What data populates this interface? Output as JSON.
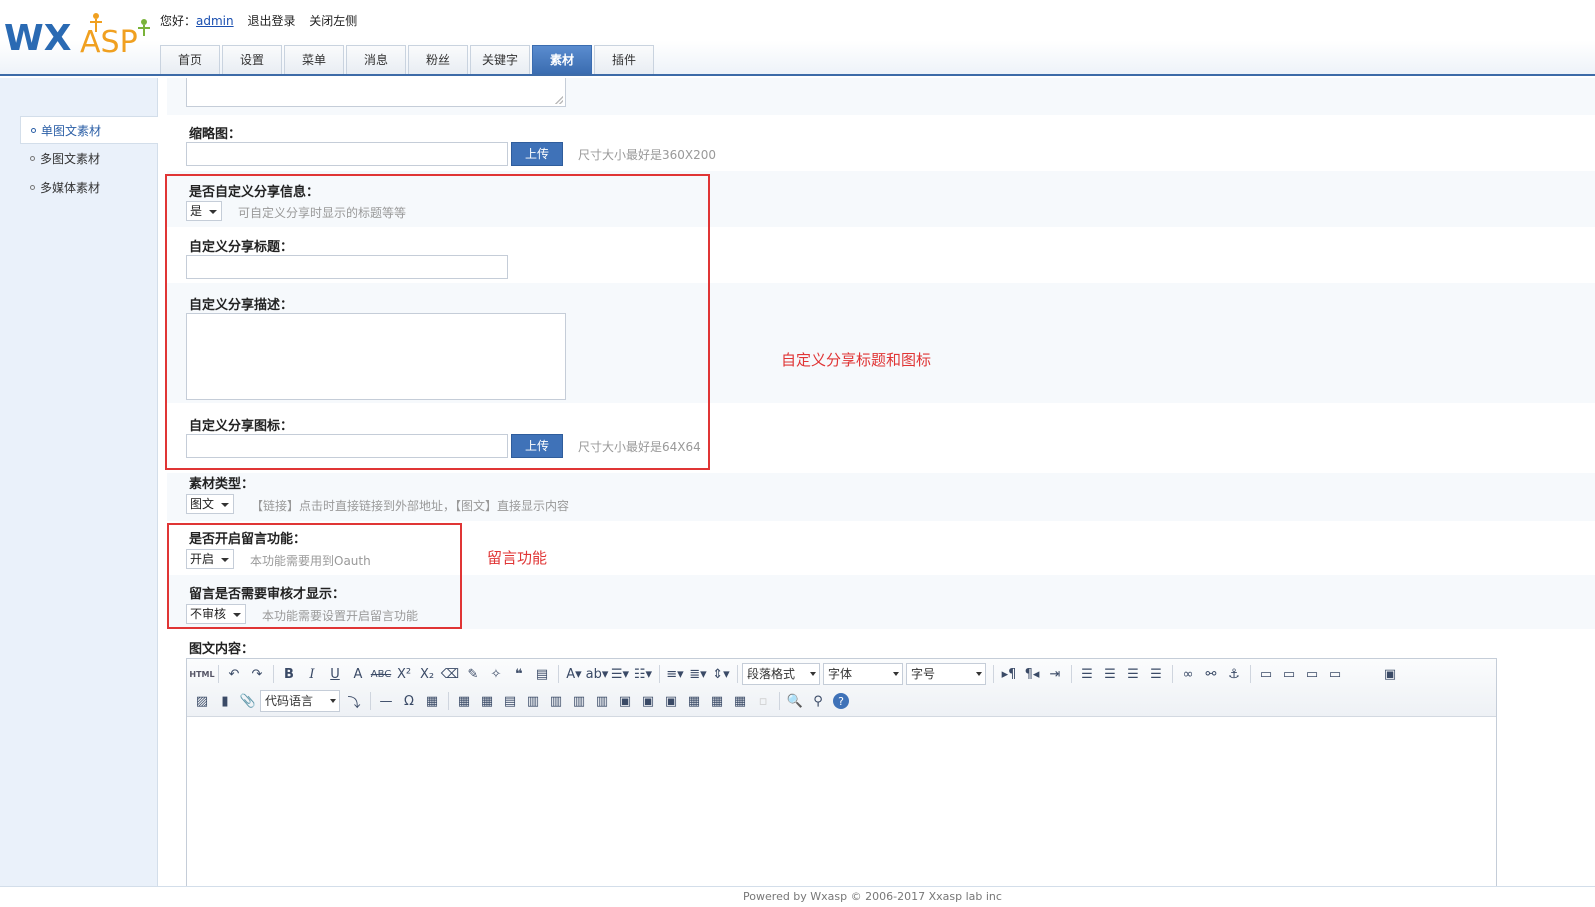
{
  "header": {
    "logo_text_wx": "WX",
    "logo_text_asp": "ASP",
    "greeting": "您好：",
    "username": "admin",
    "logout": "退出登录",
    "close_left": "关闭左侧",
    "tabs": [
      "首页",
      "设置",
      "菜单",
      "消息",
      "粉丝",
      "关键字",
      "素材",
      "插件"
    ],
    "active_tab": "素材"
  },
  "sidebar": {
    "items": [
      "单图文素材",
      "多图文素材",
      "多媒体素材"
    ],
    "active_item": "单图文素材"
  },
  "form": {
    "thumb": {
      "label": "缩略图：",
      "button": "上传",
      "hint": "尺寸大小最好是360X200",
      "value": ""
    },
    "share_custom": {
      "label": "是否自定义分享信息：",
      "value": "是",
      "hint": "可自定义分享时显示的标题等等"
    },
    "share_title": {
      "label": "自定义分享标题：",
      "value": ""
    },
    "share_desc": {
      "label": "自定义分享描述：",
      "value": ""
    },
    "share_icon": {
      "label": "自定义分享图标：",
      "button": "上传",
      "hint": "尺寸大小最好是64X64",
      "value": ""
    },
    "material_type": {
      "label": "素材类型：",
      "value": "图文",
      "hint": "【链接】点击时直接链接到外部地址，【图文】直接显示内容"
    },
    "comment_enable": {
      "label": "是否开启留言功能：",
      "value": "开启",
      "hint": "本功能需要用到Oauth"
    },
    "comment_review": {
      "label": "留言是否需要审核才显示：",
      "value": "不审核",
      "hint": "本功能需要设置开启留言功能"
    },
    "content": {
      "label": "图文内容："
    }
  },
  "annotations": {
    "share": "自定义分享标题和图标",
    "comment": "留言功能",
    "color": "#e03535"
  },
  "editor": {
    "combo_code": "代码语言",
    "combo_paragraph": "段落格式",
    "combo_font": "字体",
    "combo_size": "字号",
    "html_icon_text": "HTML"
  },
  "footer": {
    "text": "Powered by Wxasp © 2006-2017 Xxasp lab inc"
  },
  "colors": {
    "accent": "#3f72b8",
    "sidebar_bg": "#eaf1fa",
    "annotation_red": "#e03535"
  }
}
